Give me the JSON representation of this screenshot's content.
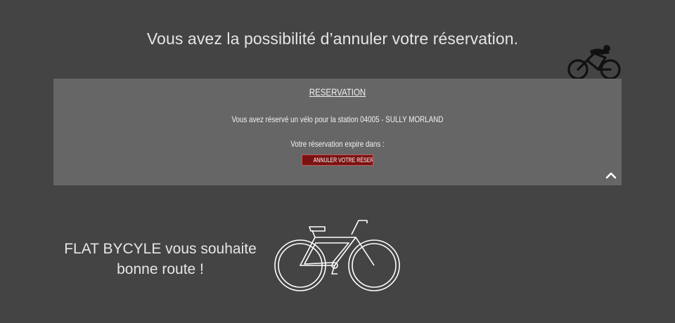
{
  "header": {
    "message": "Vous avez la possibilité d’annuler votre réservation."
  },
  "reservation": {
    "title": "RESERVATION",
    "station_text": "Vous avez réservé un vélo pour la station 04005 - SULLY MORLAND",
    "expiry_text": "Votre réservation expire dans :",
    "cancel_label": "ANNULER VOTRE RÉSERVATION"
  },
  "footer": {
    "line1": "FLAT BYCYLE vous souhaite",
    "line2": "bonne route !"
  },
  "icons": {
    "rider": "cyclist-icon",
    "collapse": "chevron-up-icon",
    "bike": "bicycle-icon"
  },
  "colors": {
    "background": "#444444",
    "panel": "#666666",
    "button": "#7a1212",
    "text": "#e6e6e6"
  }
}
